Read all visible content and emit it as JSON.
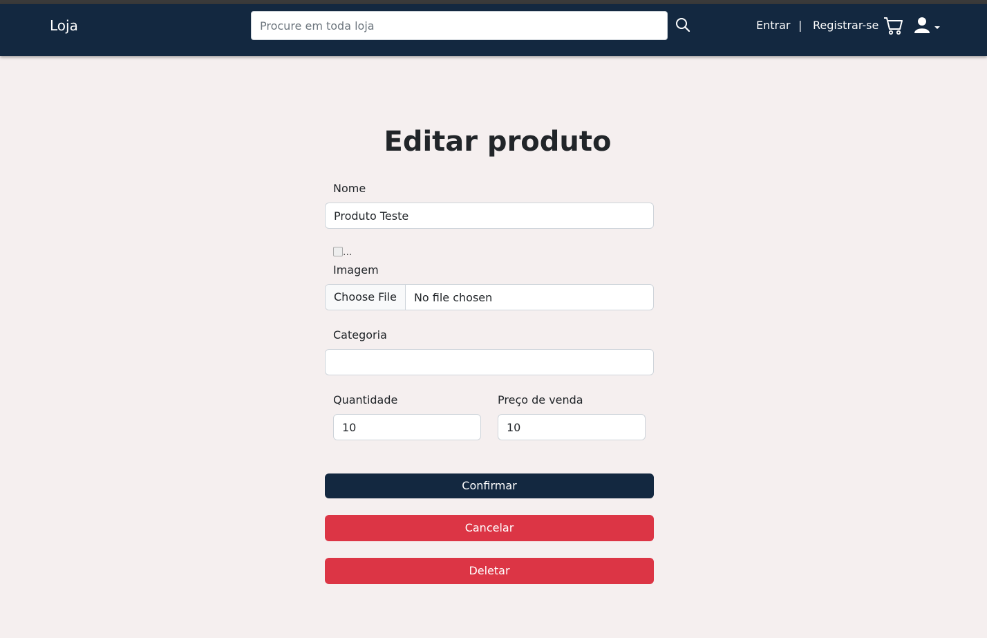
{
  "navbar": {
    "brand": "Loja",
    "search_placeholder": "Procure em toda loja",
    "search_icon": "search-icon",
    "login_label": "Entrar",
    "separator": "|",
    "register_label": "Registrar-se",
    "cart_icon": "cart-icon",
    "user_icon": "user-icon"
  },
  "form": {
    "title": "Editar produto",
    "name_label": "Nome",
    "name_value": "Produto Teste",
    "image_alt": "...",
    "image_label": "Imagem",
    "file_button": "Choose File",
    "file_status": "No file chosen",
    "category_label": "Categoria",
    "category_value": "",
    "quantity_label": "Quantidade",
    "quantity_value": "10",
    "price_label": "Preço de venda",
    "price_value": "10",
    "confirm_label": "Confirmar",
    "cancel_label": "Cancelar",
    "delete_label": "Deletar"
  },
  "colors": {
    "navbar": "#132840",
    "page_background": "#f5efef",
    "primary_button": "#132840",
    "danger_button": "#dc3545"
  }
}
